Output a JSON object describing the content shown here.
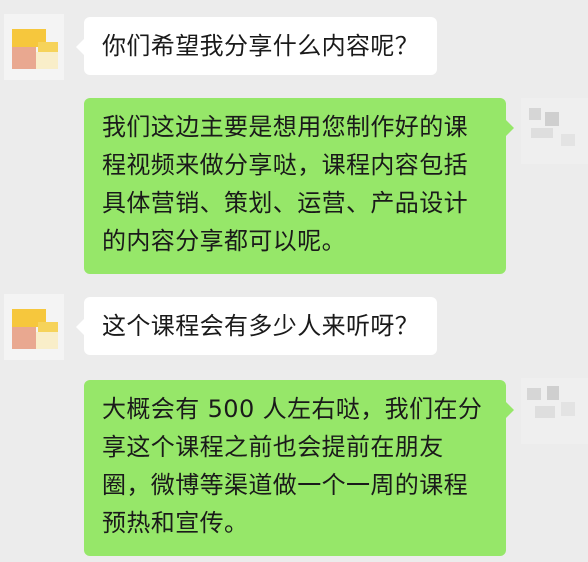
{
  "conversation": {
    "messages": [
      {
        "sender": "other",
        "avatar_icon": "pixelated-avatar-icon",
        "text": "你们希望我分享什么内容呢？"
      },
      {
        "sender": "me",
        "avatar_icon": "blurred-avatar-icon",
        "text": "我们这边主要是想用您制作好的课程视频来做分享哒，课程内容包括具体营销、策划、运营、产品设计的内容分享都可以呢。"
      },
      {
        "sender": "other",
        "avatar_icon": "pixelated-avatar-icon",
        "text": "这个课程会有多少人来听呀？"
      },
      {
        "sender": "me",
        "avatar_icon": "blurred-avatar-icon",
        "text": "大概会有 500 人左右哒，我们在分享这个课程之前也会提前在朋友圈，微博等渠道做一个一周的课程预热和宣传。"
      }
    ]
  },
  "colors": {
    "background": "#ececec",
    "incoming_bubble": "#ffffff",
    "outgoing_bubble": "#96e769"
  }
}
